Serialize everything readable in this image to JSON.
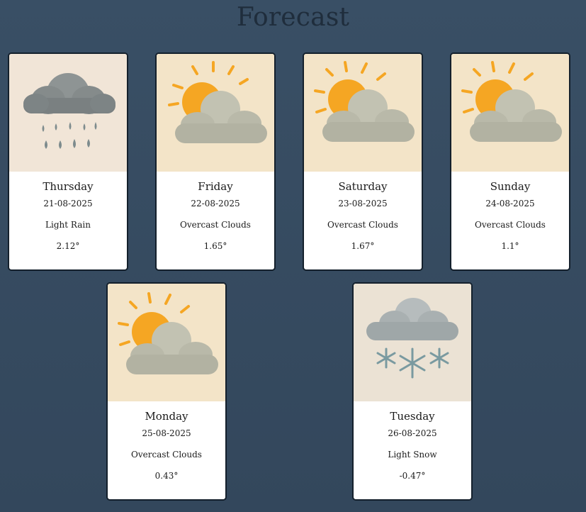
{
  "header": {
    "title": "Forecast"
  },
  "colors": {
    "page_bg": "#394f65",
    "card_border": "#14202c",
    "sun": "#f5a623",
    "cloud": "#b9b9a9",
    "rain_cloud": "#7d8485",
    "snow": "#7a9aa0"
  },
  "forecast": [
    {
      "day": "Thursday",
      "date": "21-08-2025",
      "description": "Light Rain",
      "temperature": "2.12°",
      "icon": "rain-cloud-icon"
    },
    {
      "day": "Friday",
      "date": "22-08-2025",
      "description": "Overcast Clouds",
      "temperature": "1.65°",
      "icon": "sun-behind-cloud-icon"
    },
    {
      "day": "Saturday",
      "date": "23-08-2025",
      "description": "Overcast Clouds",
      "temperature": "1.67°",
      "icon": "sun-behind-cloud-icon"
    },
    {
      "day": "Sunday",
      "date": "24-08-2025",
      "description": "Overcast Clouds",
      "temperature": "1.1°",
      "icon": "sun-behind-cloud-icon"
    },
    {
      "day": "Monday",
      "date": "25-08-2025",
      "description": "Overcast Clouds",
      "temperature": "0.43°",
      "icon": "sun-behind-cloud-icon"
    },
    {
      "day": "Tuesday",
      "date": "26-08-2025",
      "description": "Light Snow",
      "temperature": "-0.47°",
      "icon": "snow-cloud-icon"
    }
  ]
}
